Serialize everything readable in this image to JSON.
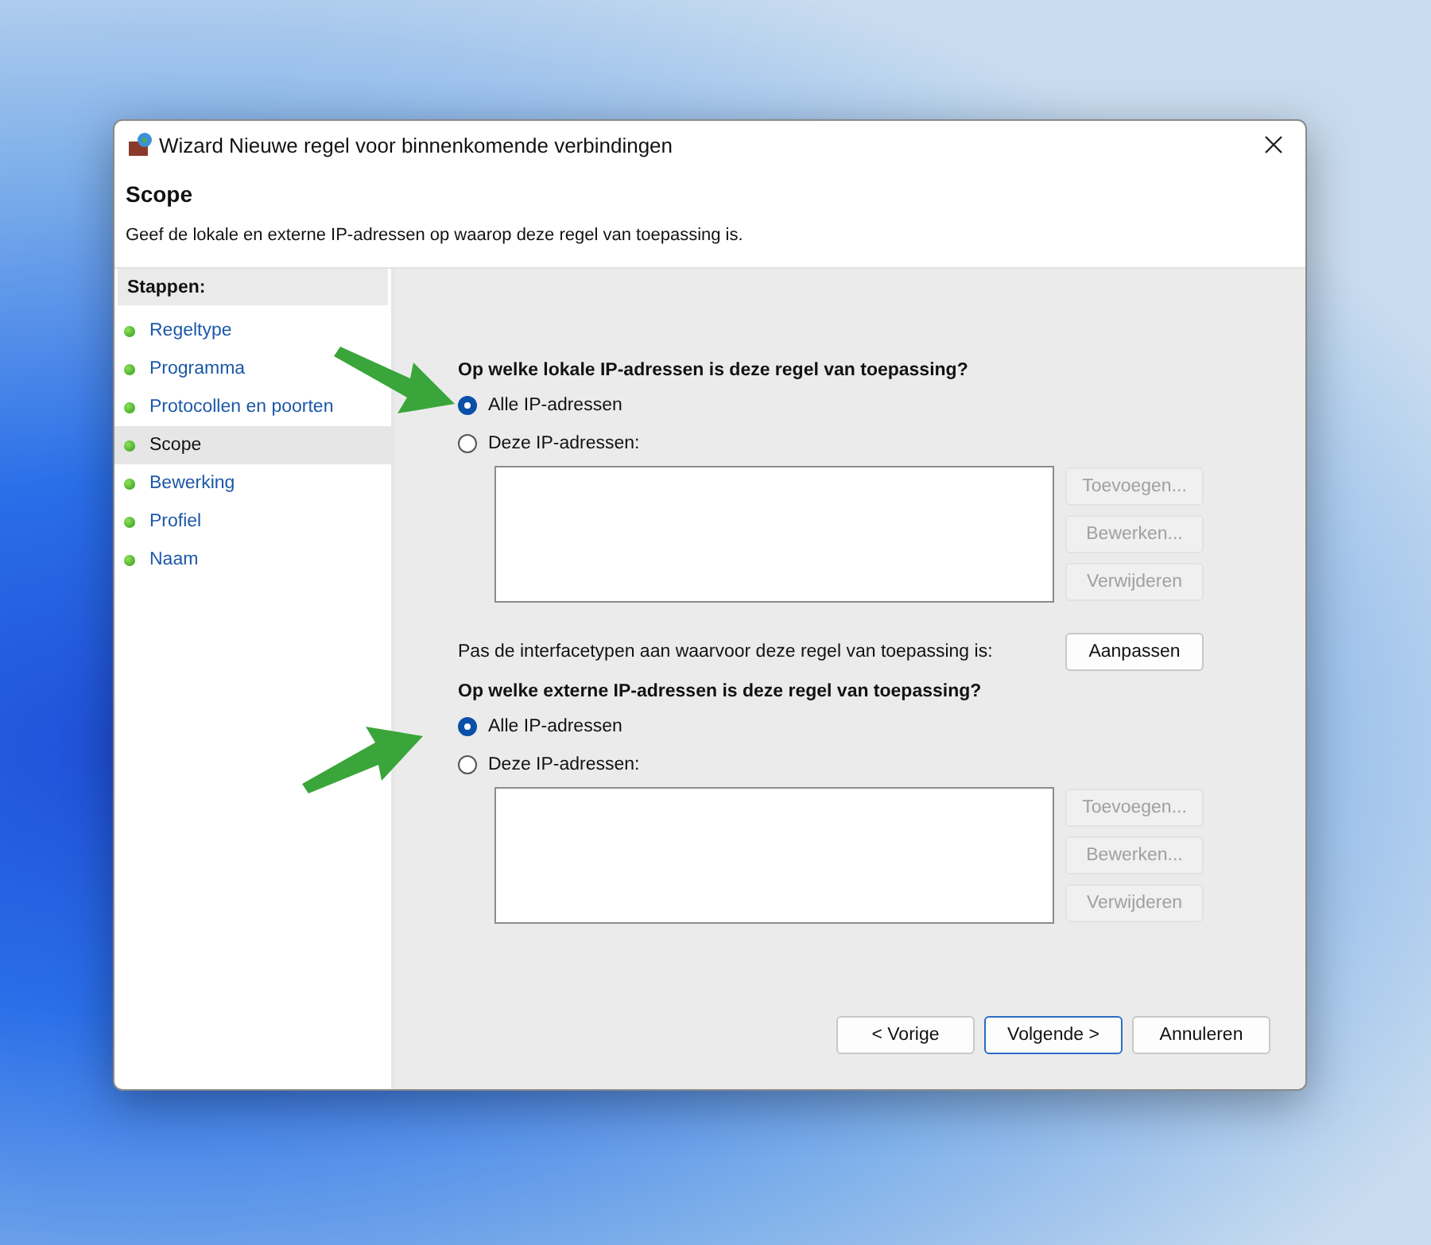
{
  "window": {
    "title": "Wizard Nieuwe regel voor binnenkomende verbindingen"
  },
  "header": {
    "title": "Scope",
    "description": "Geef de lokale en externe IP-adressen op waarop deze regel van toepassing is."
  },
  "sidebar": {
    "heading": "Stappen:",
    "items": [
      {
        "label": "Regeltype",
        "selected": false
      },
      {
        "label": "Programma",
        "selected": false
      },
      {
        "label": "Protocollen en poorten",
        "selected": false
      },
      {
        "label": "Scope",
        "selected": true
      },
      {
        "label": "Bewerking",
        "selected": false
      },
      {
        "label": "Profiel",
        "selected": false
      },
      {
        "label": "Naam",
        "selected": false
      }
    ]
  },
  "sections": [
    {
      "question": "Op welke lokale IP-adressen is deze regel van toepassing?",
      "options": [
        {
          "label": "Alle IP-adressen",
          "selected": true
        },
        {
          "label": "Deze IP-adressen:",
          "selected": false
        }
      ],
      "list_buttons": [
        {
          "label": "Toevoegen...",
          "disabled": true
        },
        {
          "label": "Bewerken...",
          "disabled": true
        },
        {
          "label": "Verwijderen",
          "disabled": true
        }
      ],
      "interface_row": {
        "label": "Pas de interfacetypen aan waarvoor deze regel van toepassing is:",
        "button": "Aanpassen"
      }
    },
    {
      "question": "Op welke externe IP-adressen is deze regel van toepassing?",
      "options": [
        {
          "label": "Alle IP-adressen",
          "selected": true
        },
        {
          "label": "Deze IP-adressen:",
          "selected": false
        }
      ],
      "list_buttons": [
        {
          "label": "Toevoegen...",
          "disabled": true
        },
        {
          "label": "Bewerken...",
          "disabled": true
        },
        {
          "label": "Verwijderen",
          "disabled": true
        }
      ]
    }
  ],
  "footer": {
    "buttons": [
      {
        "label": "< Vorige",
        "focused": false
      },
      {
        "label": "Volgende >",
        "focused": true
      },
      {
        "label": "Annuleren",
        "focused": false
      }
    ]
  }
}
